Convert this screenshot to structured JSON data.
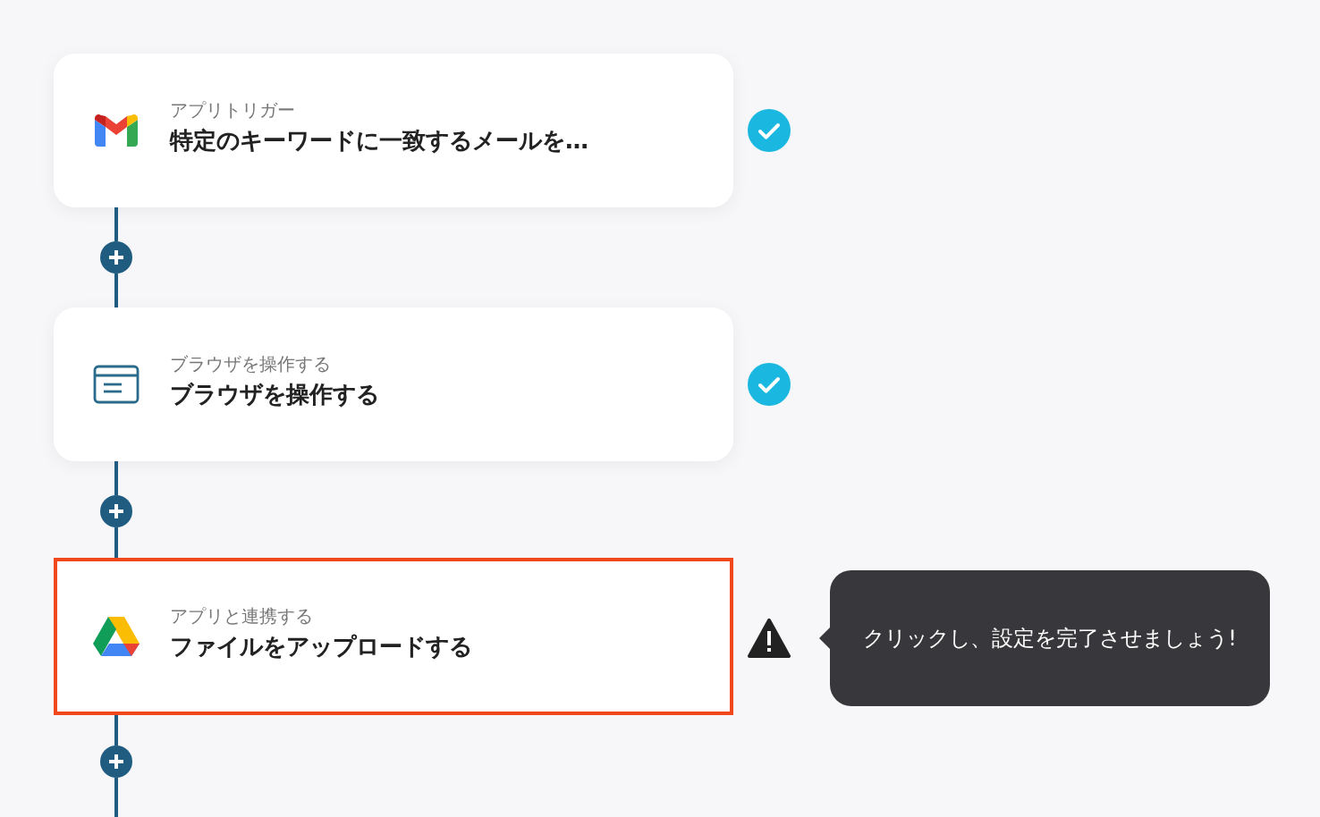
{
  "steps": [
    {
      "kind": "gmail",
      "label": "アプリトリガー",
      "title": "特定のキーワードに一致するメールを…",
      "complete": true,
      "selected": false
    },
    {
      "kind": "browser",
      "label": "ブラウザを操作する",
      "title": "ブラウザを操作する",
      "complete": true,
      "selected": false
    },
    {
      "kind": "drive",
      "label": "アプリと連携する",
      "title": "ファイルをアップロードする",
      "complete": false,
      "selected": true,
      "hint": "クリックし、設定を完了させましょう!"
    }
  ]
}
